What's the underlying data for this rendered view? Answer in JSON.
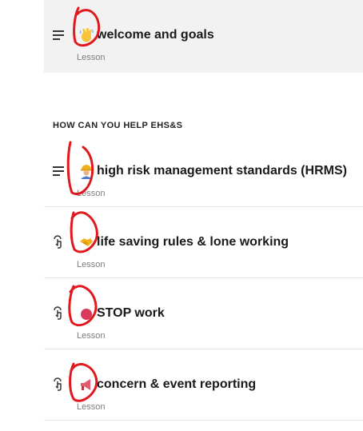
{
  "outline": {
    "lessons_top": [
      {
        "emoji_icon": "waving-hand-icon",
        "title": "welcome and goals",
        "type": "Lesson",
        "type_icon": "list-lines-icon",
        "active": true
      }
    ],
    "section_heading": "HOW CAN YOU HELP EHS&S",
    "lessons": [
      {
        "emoji_icon": "construction-worker-icon",
        "title": "high risk management standards (HRMS)",
        "type": "Lesson",
        "type_icon": "list-lines-icon"
      },
      {
        "emoji_icon": "handshake-icon",
        "title": "life saving rules & lone working",
        "type": "Lesson",
        "type_icon": "touch-pointer-icon"
      },
      {
        "emoji_icon": "red-circle-icon",
        "title": "STOP work",
        "type": "Lesson",
        "type_icon": "touch-pointer-icon"
      },
      {
        "emoji_icon": "megaphone-icon",
        "title": "concern & event reporting",
        "type": "Lesson",
        "type_icon": "touch-pointer-icon"
      }
    ]
  },
  "colors": {
    "active_background": "#f2f2f2",
    "annotation_red": "#e0191f",
    "divider": "#e6e6e6",
    "muted_text": "#7d7d7d"
  }
}
